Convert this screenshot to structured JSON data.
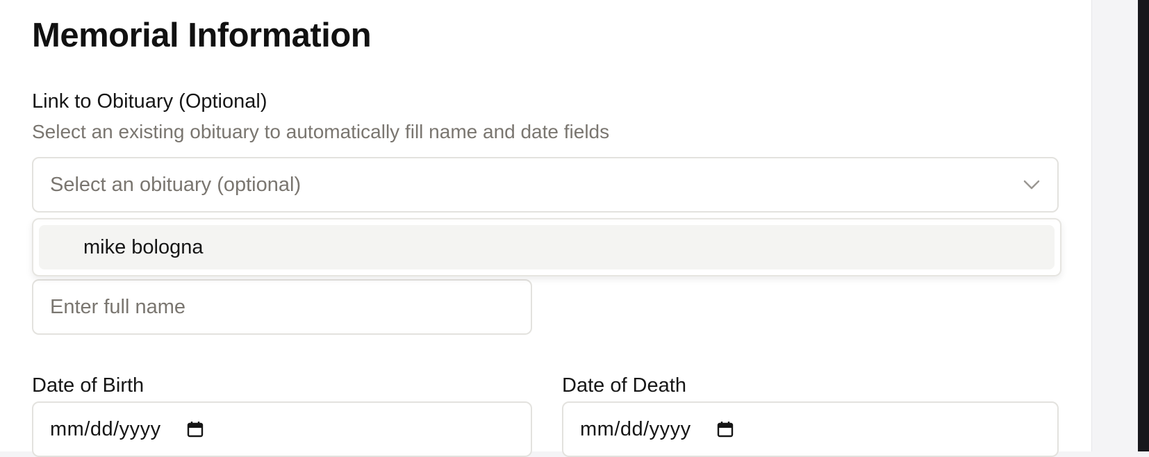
{
  "page": {
    "title": "Memorial Information"
  },
  "obituary": {
    "label": "Link to Obituary (Optional)",
    "helper": "Select an existing obituary to automatically fill name and date fields",
    "select_placeholder": "Select an obituary (optional)",
    "options": [
      {
        "label": "mike bologna"
      }
    ]
  },
  "name": {
    "placeholder": "Enter full name"
  },
  "dates": {
    "birth_label": "Date of Birth",
    "birth_value": "mm/dd/yyyy",
    "death_label": "Date of Death",
    "death_value": "mm/dd/yyyy"
  },
  "icons": {
    "select_chevron": "chevron-down-icon",
    "date_picker": "calendar-icon"
  },
  "colors": {
    "text": "#161616",
    "muted": "#7a7670",
    "border": "#e3e2de",
    "option_highlight": "#f4f4f2"
  }
}
